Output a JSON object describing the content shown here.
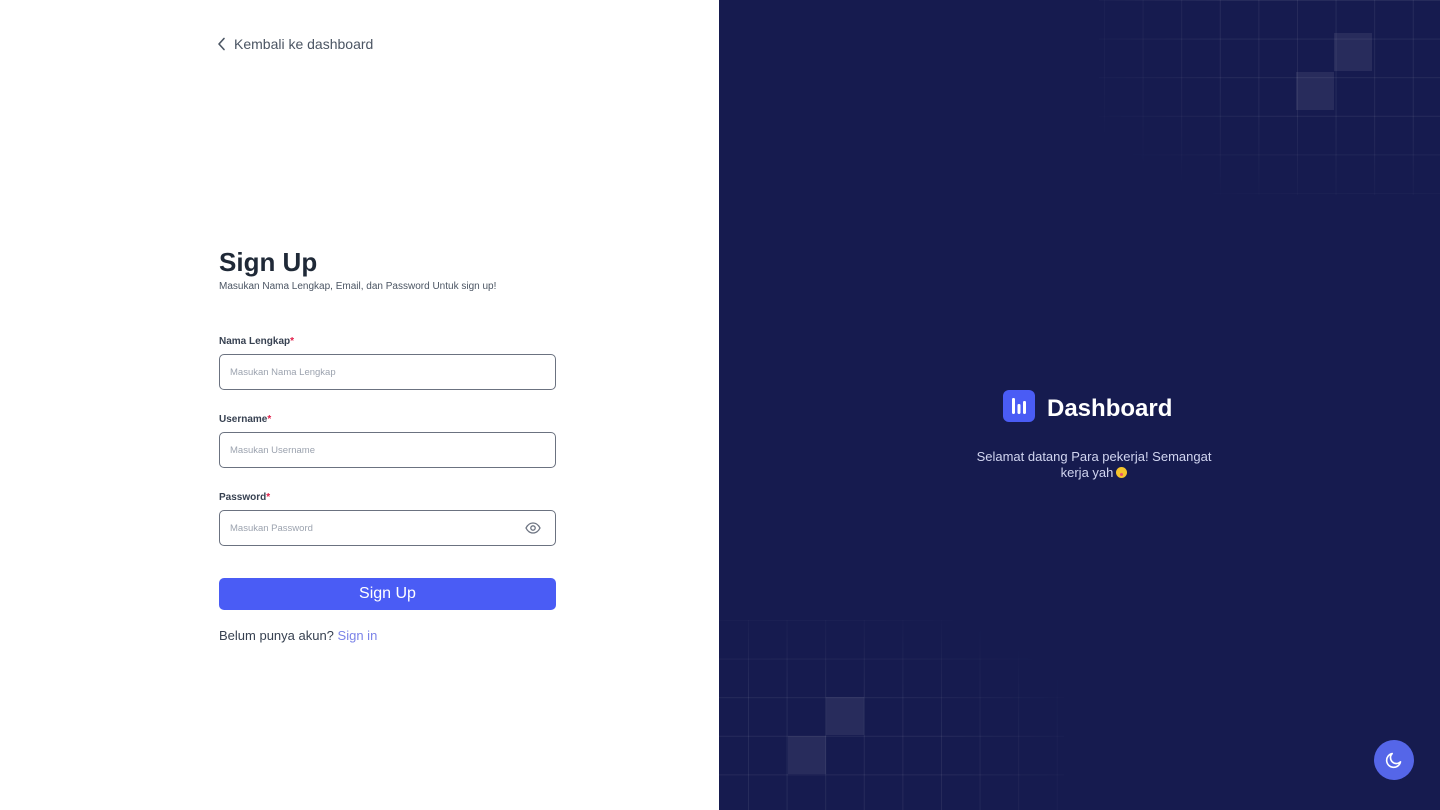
{
  "back_link": {
    "icon": "chevron-left-icon",
    "label": "Kembali ke dashboard"
  },
  "form": {
    "title": "Sign Up",
    "subtitle": "Masukan Nama Lengkap, Email, dan Password Untuk sign up!",
    "required_marker": "*",
    "fields": [
      {
        "label": "Nama Lengkap",
        "placeholder": "Masukan Nama Lengkap",
        "value": ""
      },
      {
        "label": "Username",
        "placeholder": "Masukan Username",
        "value": ""
      },
      {
        "label": "Password",
        "placeholder": "Masukan Password",
        "value": "",
        "icon": "eye-icon"
      }
    ],
    "submit_label": "Sign Up",
    "footer_text": "Belum punya akun?",
    "footer_link": "Sign in"
  },
  "brand": {
    "name": "Dashboard",
    "logo_icon": "bar-chart-icon",
    "welcome": "Selamat datang Para pekerja! Semangat kerja yah",
    "welcome_emoji_icon": "face-with-tongue-icon"
  },
  "theme_toggle": {
    "icon": "moon-icon"
  },
  "colors": {
    "primary": "#4a5cf5",
    "right_panel_bg": "#161b4f",
    "required": "#e11d48",
    "link": "#7b83e8"
  }
}
